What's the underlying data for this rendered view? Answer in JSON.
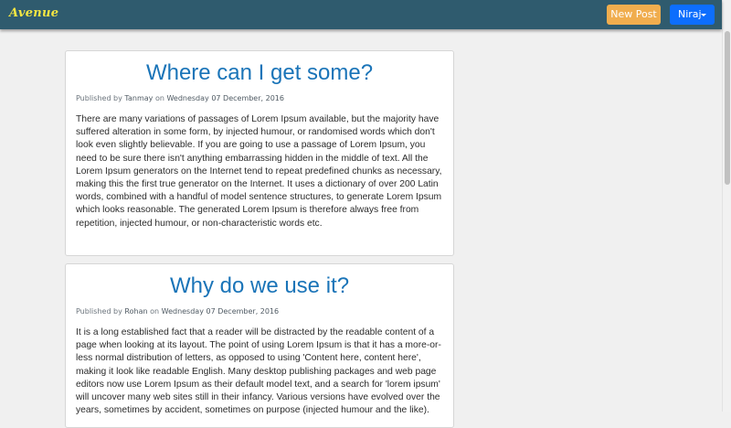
{
  "navbar": {
    "brand": "Avenue",
    "new_post_label": "New Post",
    "user_label": "Niraj"
  },
  "posts": [
    {
      "title": "Where can I get some?",
      "published_by_label": "Published by",
      "author": "Tanmay",
      "on_label": "on",
      "date": "Wednesday 07 December, 2016",
      "body": "There are many variations of passages of Lorem Ipsum available, but the majority have suffered alteration in some form, by injected humour, or randomised words which don't look even slightly believable. If you are going to use a passage of Lorem Ipsum, you need to be sure there isn't anything embarrassing hidden in the middle of text. All the Lorem Ipsum generators on the Internet tend to repeat predefined chunks as necessary, making this the first true generator on the Internet. It uses a dictionary of over 200 Latin words, combined with a handful of model sentence structures, to generate Lorem Ipsum which looks reasonable. The generated Lorem Ipsum is therefore always free from repetition, injected humour, or non-characteristic words etc."
    },
    {
      "title": "Why do we use it?",
      "published_by_label": "Published by",
      "author": "Rohan",
      "on_label": "on",
      "date": "Wednesday 07 December, 2016",
      "body": "It is a long established fact that a reader will be distracted by the readable content of a page when looking at its layout. The point of using Lorem Ipsum is that it has a more-or-less normal distribution of letters, as opposed to using 'Content here, content here', making it look like readable English. Many desktop publishing packages and web page editors now use Lorem Ipsum as their default model text, and a search for 'lorem ipsum' will uncover many web sites still in their infancy. Various versions have evolved over the years, sometimes by accident, sometimes on purpose (injected humour and the like)."
    }
  ]
}
